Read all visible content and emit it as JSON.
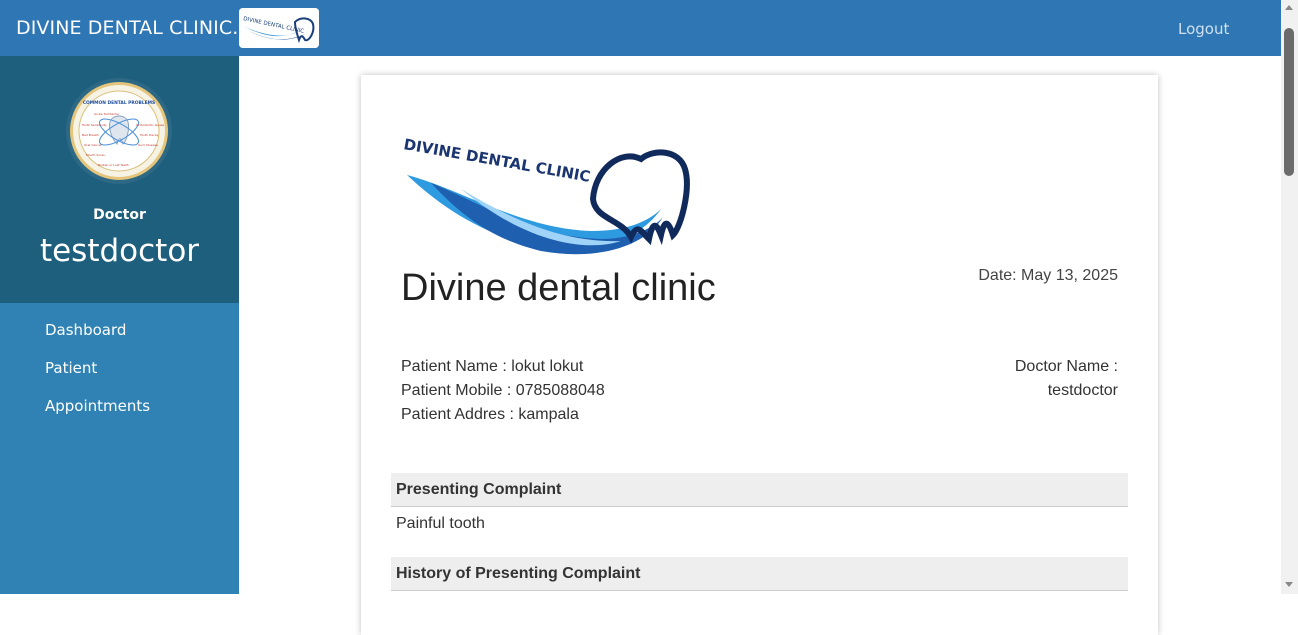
{
  "header": {
    "brand": "DIVINE DENTAL CLINIC.",
    "logout_label": "Logout",
    "bar_color": "#2f76b5"
  },
  "sidebar": {
    "role": "Doctor",
    "username": "testdoctor",
    "items": [
      {
        "label": "Dashboard"
      },
      {
        "label": "Patient"
      },
      {
        "label": "Appointments"
      }
    ],
    "avatar_text": {
      "title": "COMMON DENTAL PROBLEMS",
      "labels": [
        "Acute Toothache",
        "Tooth Sensitivity",
        "Orthodontic Issues",
        "Bad Breath",
        "Tooth Decay",
        "Oral Cancer",
        "Gum Disease",
        "Mouth Sores",
        "Broken or Lost Teeth"
      ]
    },
    "color": "#2f82b3",
    "profile_color": "#1f5f7e"
  },
  "report": {
    "logo_text": "DIVINE DENTAL CLINIC",
    "clinic_name": "Divine dental clinic",
    "date": "Date: May 13, 2025",
    "patient_name": "Patient Name : lokut lokut",
    "patient_mobile": "Patient Mobile : 0785088048",
    "patient_address": "Patient Addres : kampala",
    "doctor_label": "Doctor Name :",
    "doctor_name": "testdoctor",
    "sections": [
      {
        "title": "Presenting Complaint",
        "body": "Painful tooth"
      },
      {
        "title": "History of Presenting Complaint",
        "body": ""
      }
    ]
  }
}
